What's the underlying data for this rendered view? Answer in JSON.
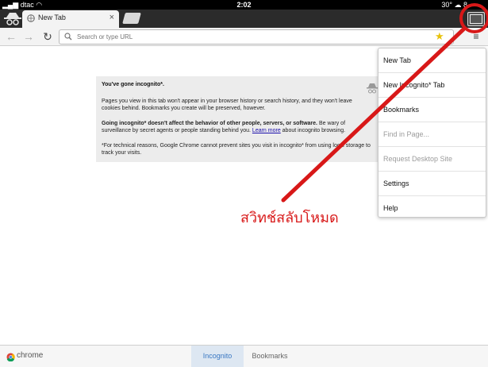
{
  "status_bar": {
    "carrier": "dtac",
    "time": "2:02",
    "temperature": "30°",
    "battery": "8"
  },
  "tab": {
    "title": "New Tab",
    "close_label": "×"
  },
  "toolbar": {
    "back": "←",
    "forward": "→",
    "reload": "↻",
    "omnibox_placeholder": "Search or type URL",
    "star": "★",
    "menu": "≡"
  },
  "incognito": {
    "heading": "You've gone incognito*.",
    "p1": "Pages you view in this tab won't appear in your browser history or search history, and they won't leave cookies behind. Bookmarks you create will be preserved, however.",
    "p2_bold": "Going incognito* doesn't affect the behavior of other people, servers, or software.",
    "p2_rest": " Be wary of surveillance by secret agents or people standing behind you.",
    "p2_link": "Learn more",
    "p2_tail": " about incognito browsing.",
    "p3": "*For technical reasons, Google Chrome cannot prevent sites you visit in incognito* from using local storage to track your visits."
  },
  "menu": {
    "items": [
      {
        "label": "New Tab"
      },
      {
        "label": "New Incognito* Tab"
      },
      {
        "label": "Bookmarks"
      },
      {
        "label": "Find in Page..."
      },
      {
        "label": "Request Desktop Site"
      },
      {
        "label": "Settings"
      },
      {
        "label": "Help"
      }
    ]
  },
  "annotation": {
    "text": "สวิทช์สลับโหมด",
    "color": "#d81818"
  },
  "bottom_bar": {
    "brand": "chrome",
    "tabs": [
      {
        "label": "Incognito"
      },
      {
        "label": "Bookmarks"
      }
    ]
  },
  "colors": {
    "accent": "#3a78c3",
    "annotation": "#d81818"
  }
}
